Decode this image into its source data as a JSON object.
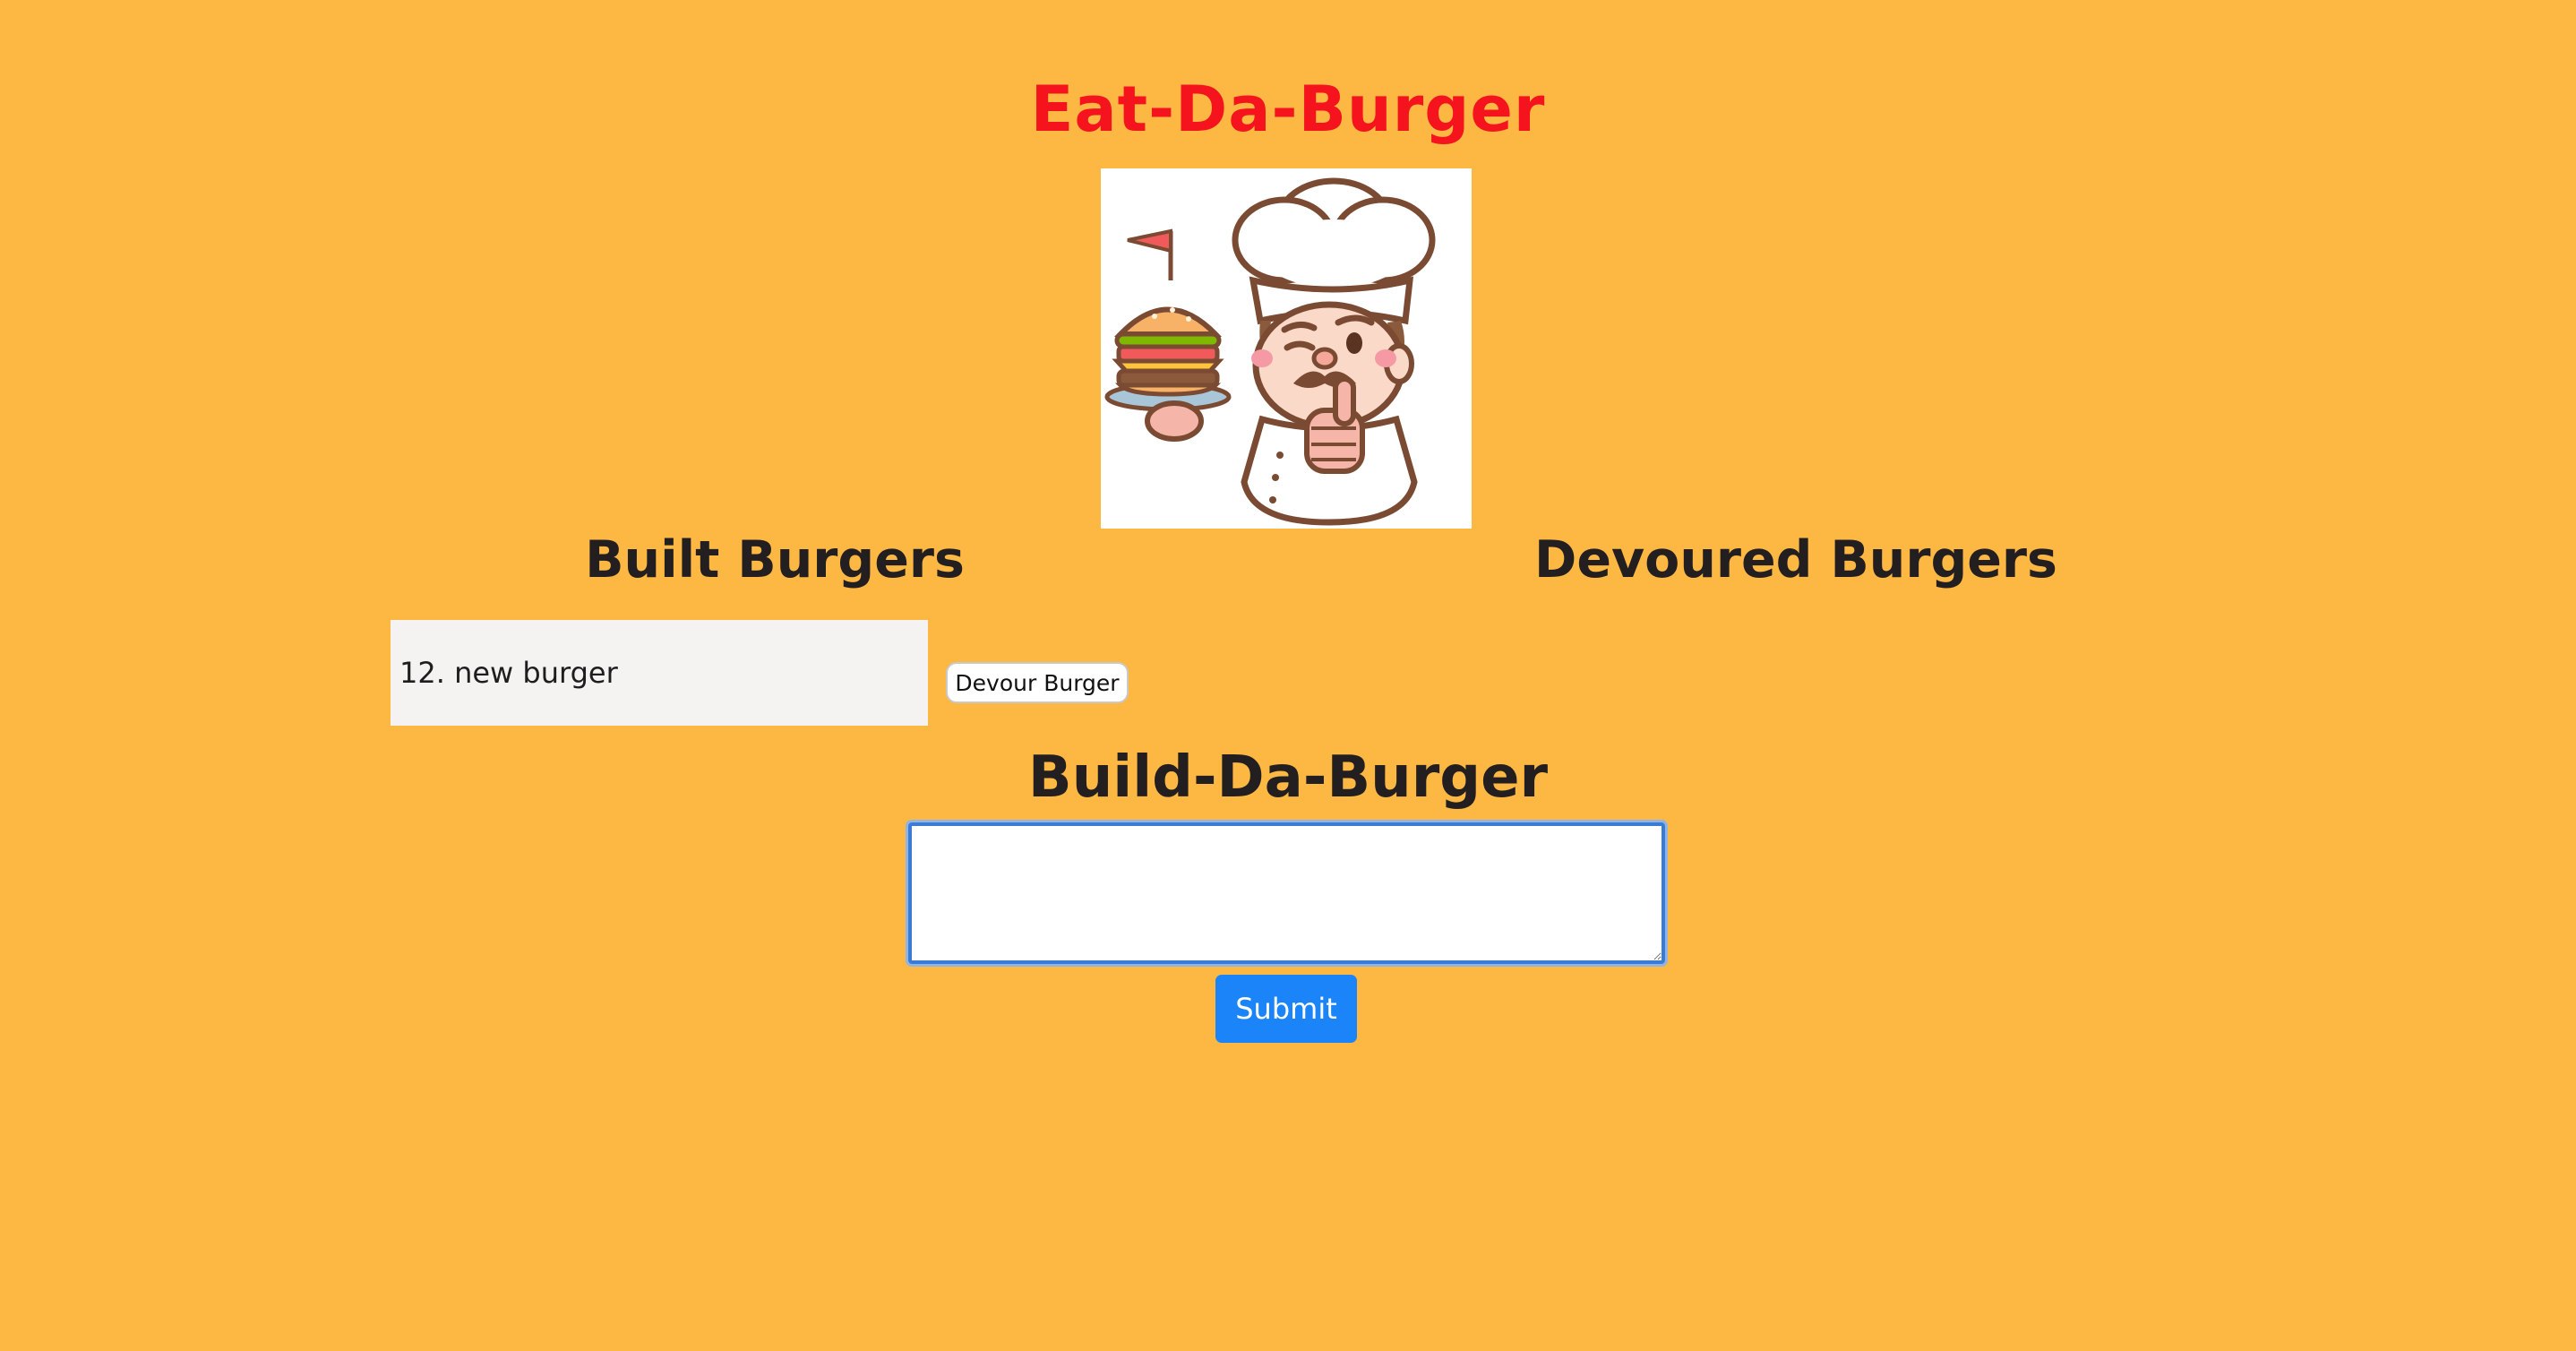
{
  "header": {
    "title": "Eat-Da-Burger"
  },
  "logo": {
    "icon": "chef-holding-burger-icon"
  },
  "sections": {
    "built_heading": "Built Burgers",
    "devoured_heading": "Devoured Burgers"
  },
  "built_burgers": [
    {
      "label": "12. new burger",
      "action_label": "Devour Burger"
    }
  ],
  "devoured_burgers": [],
  "form": {
    "heading": "Build-Da-Burger",
    "textarea_value": "",
    "submit_label": "Submit"
  },
  "colors": {
    "background": "#FDB743",
    "title": "#F5141E",
    "submit_button": "#1A84F8"
  }
}
